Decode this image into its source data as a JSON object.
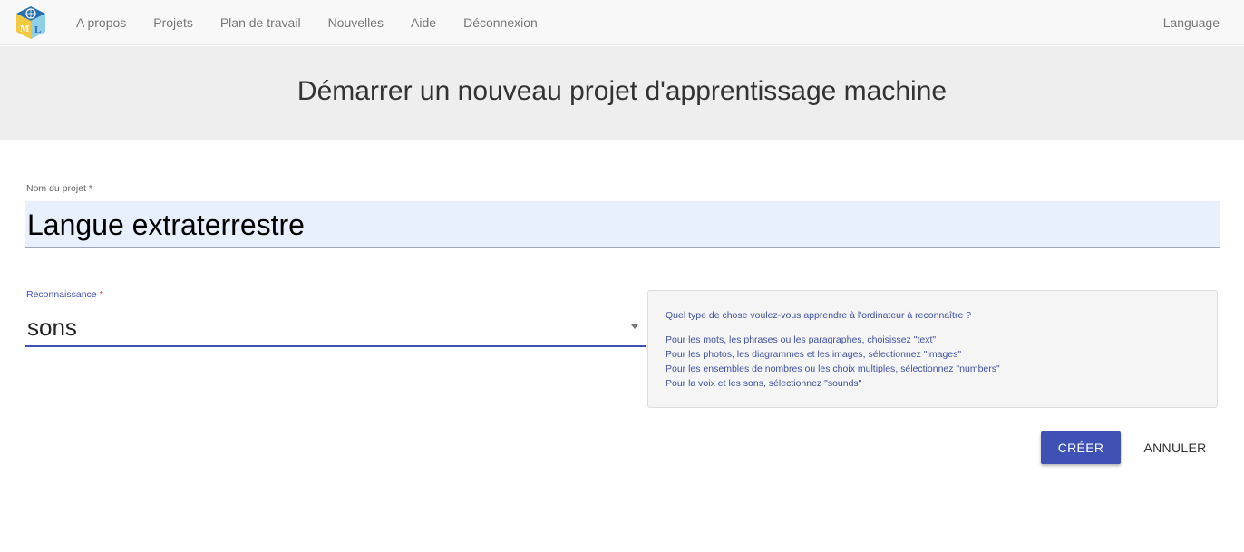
{
  "nav": {
    "logo_letters": [
      "M",
      "L"
    ],
    "links": [
      "A propos",
      "Projets",
      "Plan de travail",
      "Nouvelles",
      "Aide",
      "Déconnexion"
    ],
    "language": "Language"
  },
  "header": {
    "title": "Démarrer un nouveau projet d'apprentissage machine"
  },
  "form": {
    "name_label": "Nom du projet",
    "name_required": "*",
    "name_value": "Langue extraterrestre",
    "type_label": "Reconnaissance",
    "type_required": "*",
    "type_value": "sons"
  },
  "help": {
    "question": "Quel type de chose voulez-vous apprendre à l'ordinateur à reconnaître ?",
    "lines": [
      "Pour les mots, les phrases ou les paragraphes, choisissez \"text\"",
      "Pour les photos, les diagrammes et les images, sélectionnez \"images\"",
      "Pour les ensembles de nombres ou les choix multiples, sélectionnez \"numbers\"",
      "Pour la voix et les sons, sélectionnez \"sounds\""
    ]
  },
  "buttons": {
    "create": "CRÉER",
    "cancel": "ANNULER"
  },
  "colors": {
    "accent": "#3f51b5",
    "required": "#f44336"
  }
}
